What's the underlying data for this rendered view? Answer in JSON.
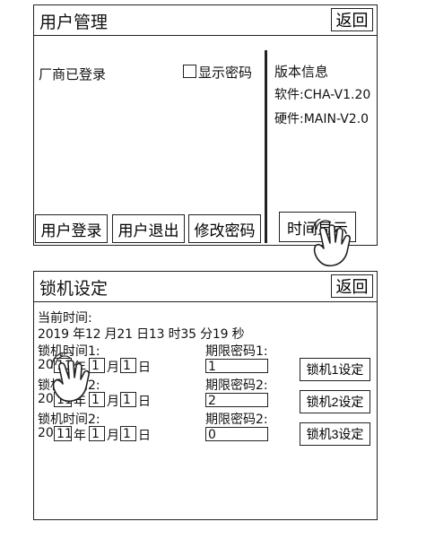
{
  "panel_user": {
    "title": "用户管理",
    "back": "返回",
    "status": "厂商已登录",
    "show_password_label": "显示密码",
    "version_title": "版本信息",
    "software": "软件:CHA-V1.20",
    "hardware": "硬件:MAIN-V2.0",
    "buttons": {
      "login": "用户登录",
      "logout": "用户退出",
      "change_pwd": "修改密码",
      "time_display": "时间显示"
    }
  },
  "panel_lock": {
    "title": "锁机设定",
    "back": "返回",
    "current_time_label": "当前时间:",
    "current_time": {
      "year": "2019",
      "year_unit": "年",
      "month": "12",
      "month_unit": "月",
      "day": "21",
      "day_unit": "日",
      "hour": "13",
      "hour_unit": "时",
      "minute": "35",
      "minute_unit": "分",
      "second": "19",
      "second_unit": "秒"
    },
    "rows": [
      {
        "label": "锁机时间1:",
        "prefix": "20",
        "yy": "11",
        "y_unit": "年",
        "mm": "1",
        "m_unit": "月",
        "dd": "1",
        "d_unit": "日",
        "pwd_label": "期限密码1:",
        "pwd": "1",
        "btn": "锁机1设定"
      },
      {
        "label": "锁机时间2:",
        "prefix": "20",
        "yy": "11",
        "y_unit": "年",
        "mm": "1",
        "m_unit": "月",
        "dd": "1",
        "d_unit": "日",
        "pwd_label": "期限密码2:",
        "pwd": "2",
        "btn": "锁机2设定"
      },
      {
        "label": "锁机时间2:",
        "prefix": "20",
        "yy": "11",
        "y_unit": "年",
        "mm": "1",
        "m_unit": "月",
        "dd": "1",
        "d_unit": "日",
        "pwd_label": "期限密码2:",
        "pwd": "0",
        "btn": "锁机3设定"
      }
    ]
  },
  "icons": {
    "pointer": "pointing-hand-icon"
  }
}
